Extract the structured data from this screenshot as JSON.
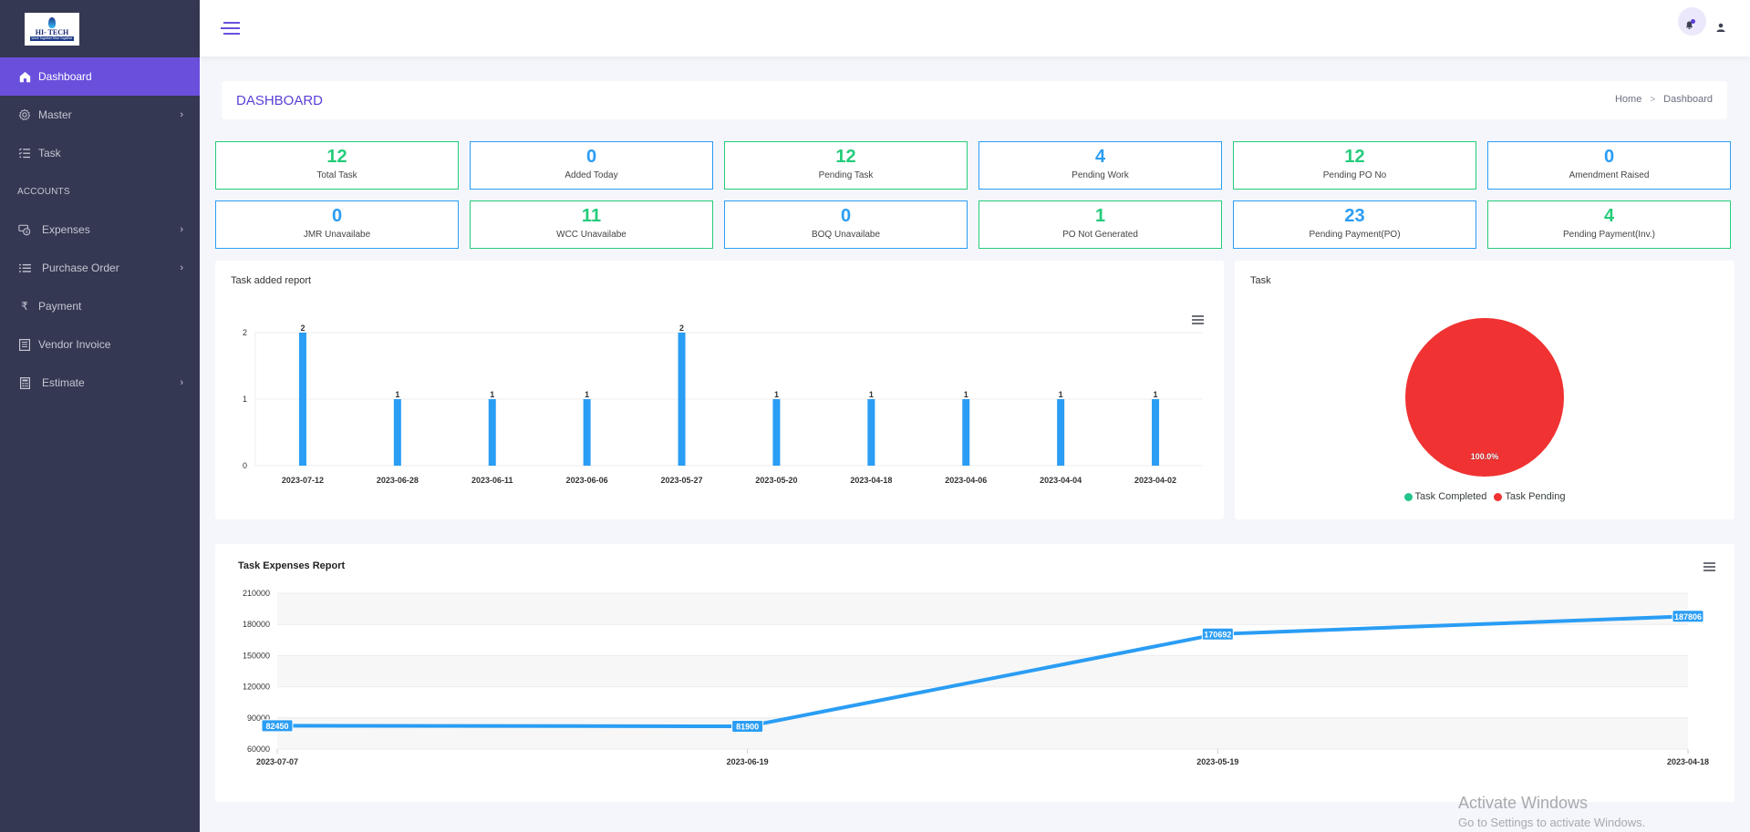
{
  "sidebar": {
    "logo": {
      "name": "HI- TECH",
      "tagline": "Work Together Rise Together"
    },
    "items": [
      {
        "label": "Dashboard",
        "icon": "home-icon",
        "active": true,
        "has_submenu": false
      },
      {
        "label": "Master",
        "icon": "gear-icon",
        "active": false,
        "has_submenu": true
      },
      {
        "label": "Task",
        "icon": "checklist-icon",
        "active": false,
        "has_submenu": false
      }
    ],
    "section_label": "ACCOUNTS",
    "account_items": [
      {
        "label": "Expenses",
        "icon": "money-icon",
        "has_submenu": true
      },
      {
        "label": "Purchase Order",
        "icon": "list-icon",
        "has_submenu": true
      },
      {
        "label": "Payment",
        "icon": "rupee-icon",
        "has_submenu": false
      },
      {
        "label": "Vendor Invoice",
        "icon": "invoice-icon",
        "has_submenu": false
      },
      {
        "label": "Estimate",
        "icon": "calculator-icon",
        "has_submenu": true
      }
    ]
  },
  "topbar": {
    "menu_icon": "hamburger-icon",
    "notification_icon": "bell-icon",
    "user_icon": "user-icon"
  },
  "page": {
    "title": "DASHBOARD",
    "breadcrumb": {
      "home": "Home",
      "separator": ">",
      "current": "Dashboard"
    }
  },
  "stats": [
    {
      "value": "12",
      "label": "Total Task",
      "color": "green"
    },
    {
      "value": "0",
      "label": "Added Today",
      "color": "blue"
    },
    {
      "value": "12",
      "label": "Pending Task",
      "color": "green"
    },
    {
      "value": "4",
      "label": "Pending Work",
      "color": "blue"
    },
    {
      "value": "12",
      "label": "Pending PO No",
      "color": "green"
    },
    {
      "value": "0",
      "label": "Amendment Raised",
      "color": "blue"
    },
    {
      "value": "0",
      "label": "JMR Unavailabe",
      "color": "blue"
    },
    {
      "value": "11",
      "label": "WCC Unavailabe",
      "color": "green"
    },
    {
      "value": "0",
      "label": "BOQ Unavailabe",
      "color": "blue"
    },
    {
      "value": "1",
      "label": "PO Not Generated",
      "color": "green"
    },
    {
      "value": "23",
      "label": "Pending Payment(PO)",
      "color": "blue"
    },
    {
      "value": "4",
      "label": "Pending Payment(Inv.)",
      "color": "green"
    }
  ],
  "colors": {
    "accent": "#6a4fdd",
    "green": "#24cc7a",
    "blue": "#2a9df4",
    "red": "#f03232",
    "sidebar": "#353852"
  },
  "chart_data": [
    {
      "type": "bar",
      "title": "Task added report",
      "categories": [
        "2023-07-12",
        "2023-06-28",
        "2023-06-11",
        "2023-06-06",
        "2023-05-27",
        "2023-05-20",
        "2023-04-18",
        "2023-04-06",
        "2023-04-04",
        "2023-04-02"
      ],
      "values": [
        2,
        1,
        1,
        1,
        2,
        1,
        1,
        1,
        1,
        1
      ],
      "yticks": [
        0,
        1,
        2
      ],
      "ylim": [
        0,
        2
      ],
      "xlabel": "",
      "ylabel": "",
      "data_labels": true,
      "grid": true,
      "color": "#2a9df4"
    },
    {
      "type": "pie",
      "title": "Task",
      "slices": [
        {
          "label": "Task Completed",
          "value": 0,
          "color": "#24c58a"
        },
        {
          "label": "Task Pending",
          "value": 100,
          "color": "#f03232"
        }
      ],
      "data_label": "100.0%",
      "legend": "bottom"
    },
    {
      "type": "line",
      "title": "Task Expenses Report",
      "x": [
        "2023-07-07",
        "2023-06-19",
        "2023-05-19",
        "2023-04-18"
      ],
      "values": [
        82450,
        81900,
        170692,
        187806
      ],
      "yticks": [
        60000,
        90000,
        120000,
        150000,
        180000,
        210000
      ],
      "ylim": [
        60000,
        210000
      ],
      "xlabel": "",
      "ylabel": "",
      "data_labels": true,
      "grid": true,
      "color": "#2a9df4"
    }
  ],
  "watermark": {
    "line1": "Activate Windows",
    "line2": "Go to Settings to activate Windows."
  }
}
